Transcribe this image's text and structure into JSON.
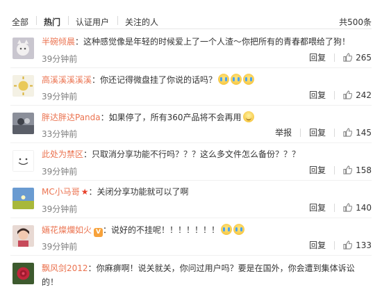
{
  "tabs": {
    "items": [
      {
        "label": "全部",
        "active": false
      },
      {
        "label": "热门",
        "active": true
      },
      {
        "label": "认证用户",
        "active": false
      },
      {
        "label": "关注的人",
        "active": false
      }
    ],
    "total": "共500条"
  },
  "colors": {
    "username": "#eb7350",
    "text": "#333333",
    "muted": "#808080",
    "accent_like": "#808080"
  },
  "comments": [
    {
      "user": "半碗倾晨",
      "colon": "：",
      "text": "这种感觉像是年轻的时候爱上了一个人渣～你把所有的青春都喂给了狗！",
      "time": "39分钟前",
      "reply": "回复",
      "likes": "265",
      "avatar": "cat-avatar"
    },
    {
      "user": "高溪溪溪溪溪",
      "colon": "：",
      "text": "你还记得微盘挂了你说的话吗？",
      "emojis": [
        "cry-emoji",
        "cry-emoji",
        "cry-emoji"
      ],
      "time": "39分钟前",
      "reply": "回复",
      "likes": "242",
      "avatar": "sun-avatar"
    },
    {
      "user": "胖达胖达Panda",
      "colon": "：",
      "text": "如果停了，所有360产品将不会再用",
      "emojis": [
        "smile-emoji"
      ],
      "time": "33分钟前",
      "report": "举报",
      "reply": "回复",
      "likes": "145",
      "avatar": "gray-avatar"
    },
    {
      "user": "此处为禁区",
      "colon": "：",
      "text": "只取消分享功能不行吗？？？这么多文件怎么备份？？？",
      "time": "39分钟前",
      "reply": "回复",
      "likes": "158",
      "avatar": "smiley-avatar"
    },
    {
      "user": "MC小马哥",
      "badge": "★",
      "colon": "：",
      "text": "关闭分享功能就可以了啊",
      "time": "39分钟前",
      "reply": "回复",
      "likes": "140",
      "avatar": "field-avatar"
    },
    {
      "user": "婳花燦爛如火",
      "vip": "V",
      "colon": "：",
      "text": "说好的不挂呢！！！！！！！",
      "emojis": [
        "cry-emoji",
        "cry-emoji"
      ],
      "time": "39分钟前",
      "reply": "回复",
      "likes": "133",
      "avatar": "girl-avatar"
    },
    {
      "user": "飘风剑2012",
      "colon": "：",
      "text": "你麻痹啊！说关就关，你问过用户吗？要是在国外，你会遭到集体诉讼的！",
      "avatar": "rose-avatar"
    }
  ]
}
